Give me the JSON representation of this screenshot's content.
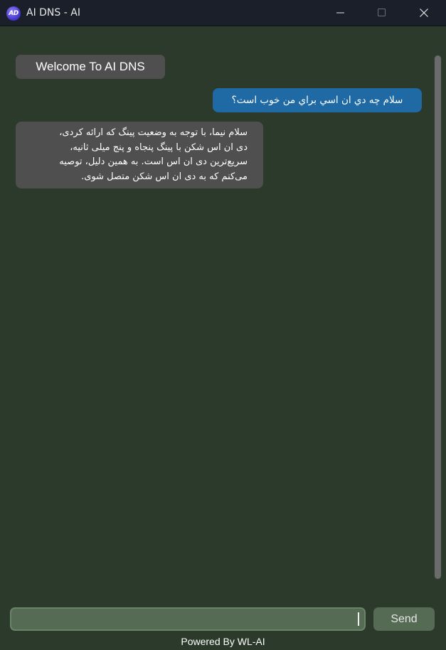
{
  "window": {
    "title": "AI DNS - AI",
    "app_icon_text": "AD",
    "controls": {
      "minimize": "minimize-icon",
      "maximize": "maximize-icon",
      "close": "close-icon"
    }
  },
  "chat": {
    "welcome": "Welcome To AI DNS",
    "messages": [
      {
        "role": "user",
        "text": "سلام چه دي ان اسي براي من خوب است؟"
      },
      {
        "role": "ai",
        "lines": [
          "سلام نیما، با توجه به وضعیت پینگ که ارائه کردی،",
          "دی ان اس شکن با پینگ پنجاه و پنج میلی ثانیه،",
          "سریع‌ترین دی ان اس است. به همین دلیل، توصیه",
          "می‌کنم که به دی ان اس شکن متصل شوی."
        ]
      }
    ]
  },
  "composer": {
    "input_value": "",
    "send_label": "Send"
  },
  "footer": {
    "powered_by": "Powered By WL-AI"
  },
  "colors": {
    "background": "#2b3a2a",
    "titlebar": "#1b1f2a",
    "user_bubble": "#1f6aa5",
    "ai_bubble": "#4f4f4f",
    "input": "#556b54",
    "send_button": "#556b54"
  }
}
